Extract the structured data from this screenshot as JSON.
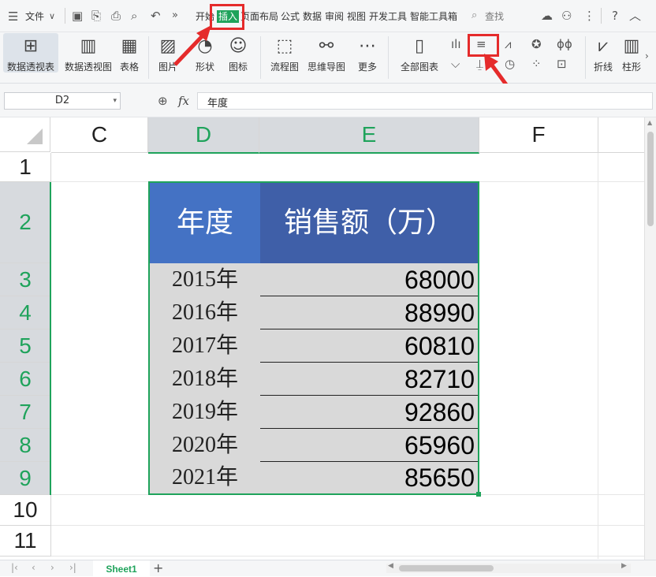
{
  "menu": {
    "file_label": "文件",
    "tabs": [
      "开始",
      "插入",
      "页面布局",
      "公式",
      "数据",
      "审阅",
      "视图",
      "开发工具",
      "智能工具箱"
    ],
    "active_tab": "插入",
    "search_label": "查找"
  },
  "ribbon": {
    "items": [
      "数据透视表",
      "数据透视图",
      "表格",
      "图片",
      "形状",
      "图标",
      "流程图",
      "思维导图",
      "更多",
      "全部图表",
      "折线",
      "柱形"
    ]
  },
  "formula": {
    "name_box": "D2",
    "fx": "fx",
    "content": "年度"
  },
  "grid": {
    "columns": [
      "C",
      "D",
      "E",
      "F"
    ],
    "rows": [
      "1",
      "2",
      "3",
      "4",
      "5",
      "6",
      "7",
      "8",
      "9",
      "10",
      "11"
    ]
  },
  "table": {
    "header_year": "年度",
    "header_sales": "销售额（万）",
    "rows": [
      {
        "year": "2015年",
        "sales": "68000"
      },
      {
        "year": "2016年",
        "sales": "88990"
      },
      {
        "year": "2017年",
        "sales": "60810"
      },
      {
        "year": "2018年",
        "sales": "82710"
      },
      {
        "year": "2019年",
        "sales": "92860"
      },
      {
        "year": "2020年",
        "sales": "65960"
      },
      {
        "year": "2021年",
        "sales": "85650"
      }
    ]
  },
  "sheets": [
    "Sheet1"
  ],
  "colors": {
    "accent": "#1fa35b",
    "header_left": "#4472c4",
    "header_right": "#3f5fa8",
    "annotation": "#e52b2b"
  }
}
